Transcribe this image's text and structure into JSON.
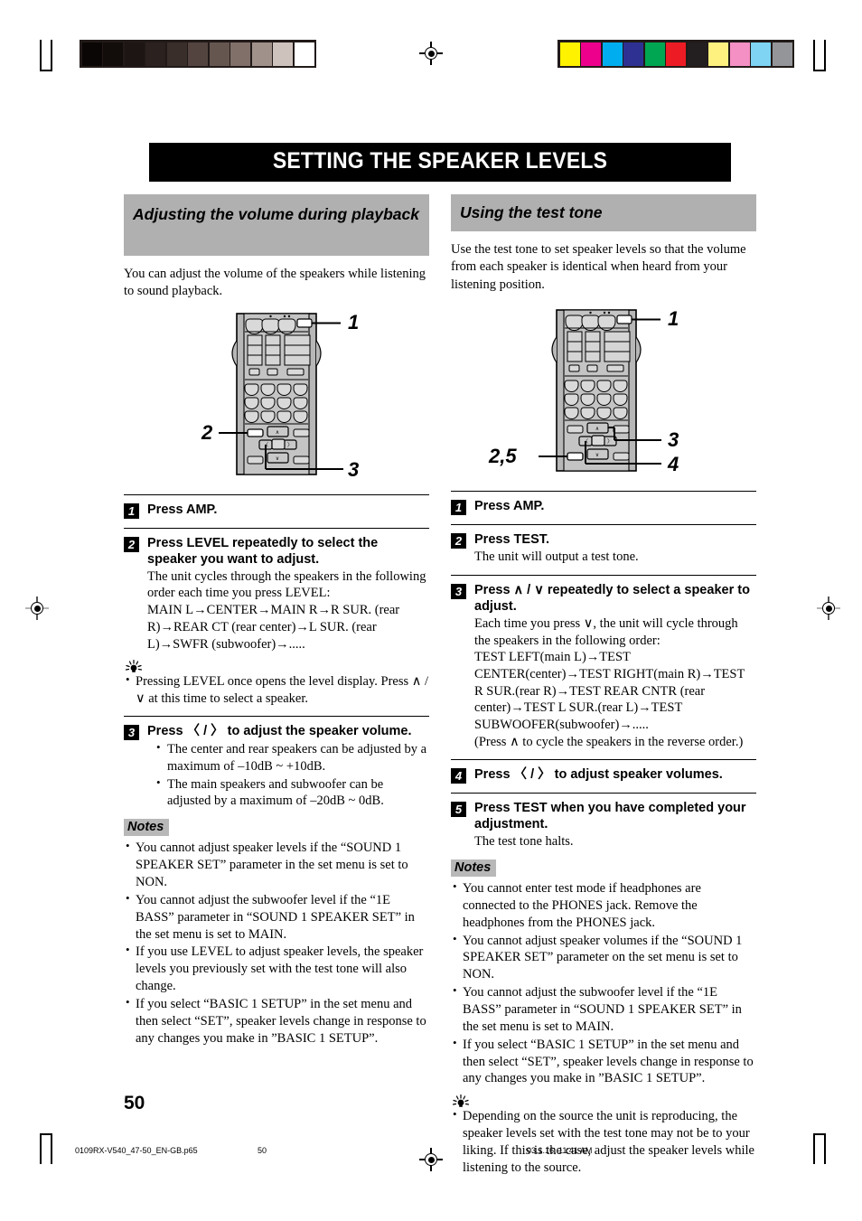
{
  "printer_marks": {
    "grayscale_swatches": [
      "#0a0605",
      "#120c0b",
      "#1c1513",
      "#2b211e",
      "#3a2e2a",
      "#53443f",
      "#665650",
      "#81706a",
      "#a1918b",
      "#cec2bd",
      "#ffffff"
    ],
    "color_swatches": [
      "#fff200",
      "#ec008c",
      "#00aeef",
      "#2e3192",
      "#00a651",
      "#ed1c24",
      "#231f20",
      "#fff17f",
      "#f490c3",
      "#7fd4f4",
      "#949599"
    ]
  },
  "chapter": {
    "title": "SETTING THE SPEAKER LEVELS"
  },
  "left_column": {
    "section_heading": "Adjusting the volume during playback",
    "intro": "You can adjust the volume of the speakers while listening to sound playback.",
    "figure": {
      "callouts": [
        "1",
        "2",
        "3"
      ],
      "alt": "remote-control-illustration"
    },
    "steps": [
      {
        "num": "1",
        "title": "Press AMP.",
        "body": []
      },
      {
        "num": "2",
        "title": "Press LEVEL repeatedly to select the speaker you want to adjust.",
        "body": [
          "The unit cycles through the speakers in the following order each time you press LEVEL:",
          "MAIN L→CENTER→MAIN R→R SUR. (rear R)→REAR CT (rear center)→L SUR. (rear L)→SWFR (subwoofer)→....."
        ]
      },
      {
        "num": "3",
        "title": "Press 〈 / 〉 to adjust the speaker volume.",
        "bullets": [
          "The center and rear speakers can be adjusted by a maximum of –10dB ~ +10dB.",
          "The main speakers and subwoofer can be adjusted by a maximum of –20dB ~ 0dB."
        ]
      }
    ],
    "tip": {
      "icon": "lightbulb-tip-icon",
      "bullets": [
        "Pressing LEVEL once opens the level display. Press ∧ / ∨ at this time to select a speaker."
      ]
    },
    "notes_label": "Notes",
    "notes": [
      "You cannot adjust speaker levels if the “SOUND 1 SPEAKER SET” parameter in the set menu is set to NON.",
      "You cannot adjust the subwoofer level if the “1E BASS” parameter in “SOUND 1 SPEAKER SET” in the set menu is set to MAIN.",
      "If you use LEVEL to adjust speaker levels, the speaker levels you previously set with the test tone will also change.",
      "If you select “BASIC 1 SETUP” in the set menu and then select “SET”, speaker levels change in response to any changes you make in ”BASIC 1 SETUP”."
    ]
  },
  "right_column": {
    "section_heading": "Using the test tone",
    "intro": "Use the test tone to set speaker levels so that the volume from each speaker is identical when heard from your listening position.",
    "figure": {
      "callouts": [
        "1",
        "3",
        "4",
        "2,5"
      ],
      "alt": "remote-control-illustration"
    },
    "steps": [
      {
        "num": "1",
        "title": "Press AMP.",
        "body": []
      },
      {
        "num": "2",
        "title": "Press TEST.",
        "body": [
          "The unit will output a test tone."
        ]
      },
      {
        "num": "3",
        "title": "Press ∧ / ∨ repeatedly to select a speaker to adjust.",
        "body": [
          "Each time you press ∨, the unit will cycle through the speakers in the following order:",
          "TEST LEFT(main L)→TEST CENTER(center)→TEST RIGHT(main R)→TEST R SUR.(rear R)→TEST REAR CNTR (rear center)→TEST L SUR.(rear L)→TEST SUBWOOFER(subwoofer)→.....",
          "(Press ∧ to cycle the speakers in the reverse order.)"
        ]
      },
      {
        "num": "4",
        "title": "Press 〈 / 〉 to adjust speaker volumes.",
        "body": []
      },
      {
        "num": "5",
        "title": "Press TEST when you have completed your adjustment.",
        "body": [
          " The test tone halts."
        ]
      }
    ],
    "notes_label": "Notes",
    "notes": [
      "You cannot enter test mode if headphones are connected to the PHONES jack. Remove the headphones from the PHONES jack.",
      "You cannot adjust speaker volumes if the “SOUND 1 SPEAKER SET” parameter on the set menu is set to NON.",
      "You cannot adjust the subwoofer level if the “1E BASS” parameter in “SOUND 1 SPEAKER SET” in the set menu is set to MAIN.",
      "If you select “BASIC 1 SETUP” in the set menu and then select “SET”, speaker levels change in response to any changes you make in ”BASIC 1 SETUP”."
    ],
    "tip": {
      "icon": "lightbulb-tip-icon",
      "bullets": [
        "Depending on the source the unit is reproducing, the speaker levels set with the test tone may not be to your liking. If this is the case, adjust the speaker levels while listening to the source."
      ]
    }
  },
  "page_number": "50",
  "footer": {
    "file": "0109RX-V540_47-50_EN-GB.p65",
    "page": "50",
    "date": "03.1.16, 11:41 AM"
  }
}
